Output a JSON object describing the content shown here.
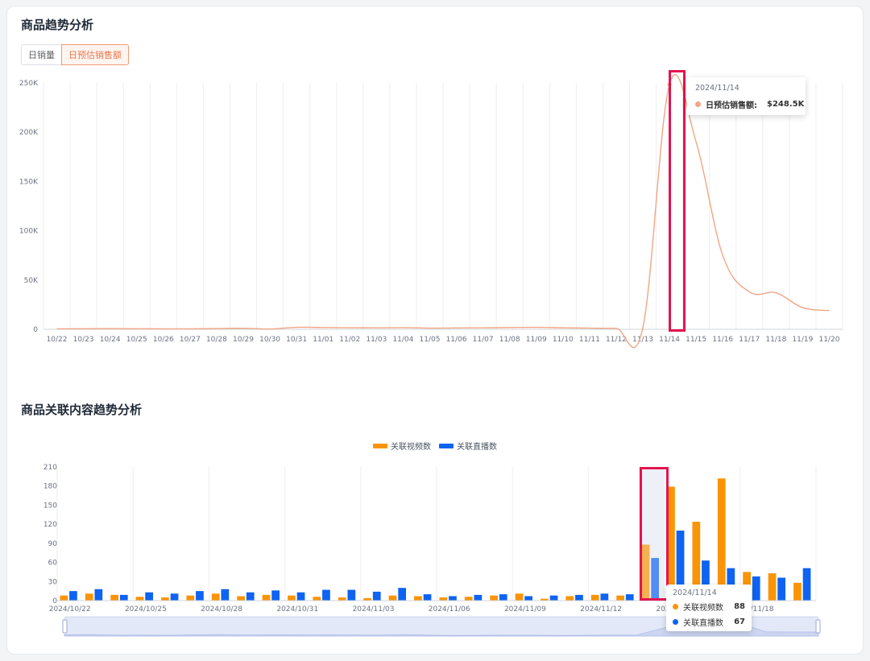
{
  "trend": {
    "title": "商品趋势分析",
    "tabs": [
      {
        "label": "日销量",
        "active": false
      },
      {
        "label": "日预估销售额",
        "active": true
      }
    ]
  },
  "related": {
    "title": "商品关联内容趋势分析"
  },
  "colors": {
    "line": "#f2a585",
    "video": "#fa9407",
    "live": "#0e63f2",
    "highlight": "#e3154f",
    "tab_active": "#e8784d"
  },
  "chart_data": [
    {
      "type": "line",
      "title": "",
      "xlabel": "",
      "ylabel": "",
      "x": [
        "10/22",
        "10/23",
        "10/24",
        "10/25",
        "10/26",
        "10/27",
        "10/28",
        "10/29",
        "10/30",
        "10/31",
        "11/01",
        "11/02",
        "11/03",
        "11/04",
        "11/05",
        "11/06",
        "11/07",
        "11/08",
        "11/09",
        "11/10",
        "11/11",
        "11/12",
        "11/13",
        "11/14",
        "11/15",
        "11/16",
        "11/17",
        "11/18",
        "11/19",
        "11/20"
      ],
      "yticks": [
        0,
        50000,
        100000,
        150000,
        200000,
        250000
      ],
      "ytick_labels": [
        "0",
        "50K",
        "100K",
        "150K",
        "200K",
        "250K"
      ],
      "ylim": [
        0,
        250000
      ],
      "series": [
        {
          "values": [
            500,
            600,
            700,
            600,
            500,
            500,
            800,
            1000,
            300,
            2000,
            1800,
            1600,
            1500,
            1700,
            1200,
            1400,
            1500,
            1800,
            2000,
            1500,
            1200,
            1000,
            1500,
            248500,
            190000,
            75000,
            38000,
            37000,
            22000,
            19000
          ]
        }
      ],
      "tooltip": {
        "date": "2024/11/14",
        "label": "日预估销售额:",
        "value": "$248.5K"
      }
    },
    {
      "type": "bar",
      "title": "",
      "xlabel": "",
      "ylabel": "",
      "categories": [
        "2024/10/22",
        "2024/10/23",
        "2024/10/24",
        "2024/10/25",
        "2024/10/26",
        "2024/10/27",
        "2024/10/28",
        "2024/10/29",
        "2024/10/30",
        "2024/10/31",
        "2024/11/01",
        "2024/11/02",
        "2024/11/03",
        "2024/11/04",
        "2024/11/05",
        "2024/11/06",
        "2024/11/07",
        "2024/11/08",
        "2024/11/09",
        "2024/11/10",
        "2024/11/11",
        "2024/11/12",
        "2024/11/13",
        "2024/11/14",
        "2024/11/15",
        "2024/11/16",
        "2024/11/17",
        "2024/11/18",
        "2024/11/19",
        "2024/11/20"
      ],
      "xtick_labels": [
        "2024/10/22",
        "2024/10/25",
        "2024/10/28",
        "2024/10/31",
        "2024/11/03",
        "2024/11/06",
        "2024/11/09",
        "2024/11/12",
        "2024/11/15",
        "2024/11/18"
      ],
      "yticks": [
        0,
        30,
        60,
        90,
        120,
        150,
        180,
        210
      ],
      "ylim": [
        0,
        210
      ],
      "legend": "top-center",
      "series": [
        {
          "name": "关联视频数",
          "values": [
            8,
            11,
            9,
            6,
            5,
            8,
            11,
            7,
            9,
            8,
            6,
            5,
            4,
            8,
            7,
            5,
            6,
            8,
            11,
            3,
            7,
            9,
            8,
            88,
            179,
            124,
            192,
            45,
            43,
            28
          ]
        },
        {
          "name": "关联直播数",
          "values": [
            15,
            18,
            9,
            13,
            11,
            15,
            18,
            13,
            16,
            13,
            17,
            17,
            14,
            20,
            10,
            7,
            9,
            10,
            7,
            8,
            9,
            11,
            10,
            67,
            110,
            63,
            51,
            38,
            36,
            51
          ]
        }
      ],
      "tooltip": {
        "date": "2024/11/14",
        "rows": [
          {
            "label": "关联视频数",
            "value": "88"
          },
          {
            "label": "关联直播数",
            "value": "67"
          }
        ]
      }
    }
  ]
}
